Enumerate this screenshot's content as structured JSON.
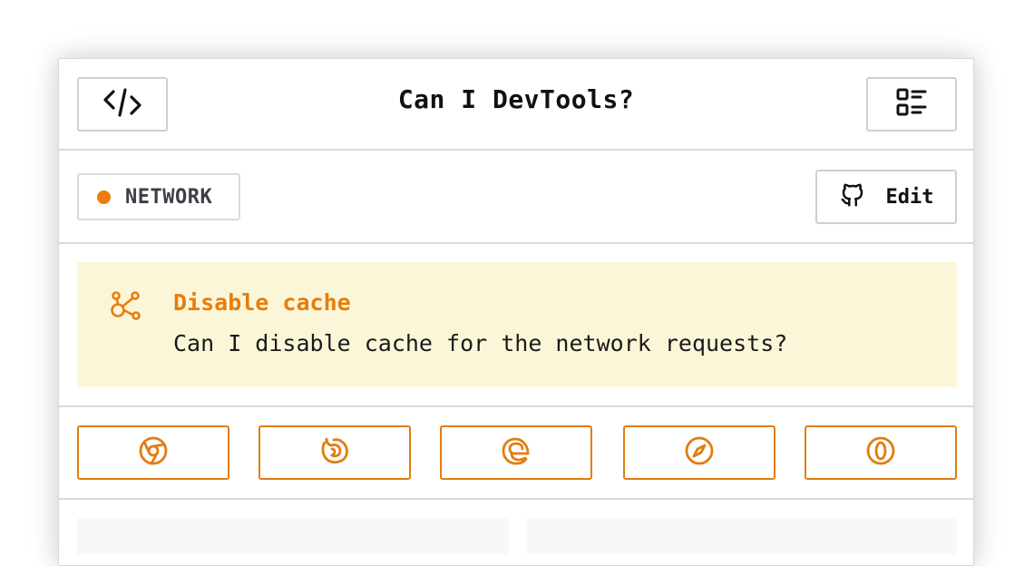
{
  "header": {
    "title": "Can I DevTools?",
    "left_icon": "code-icon",
    "right_icon": "list-icon"
  },
  "category": {
    "label": "NETWORK",
    "color": "#ea7d0c"
  },
  "edit": {
    "label": "Edit",
    "icon": "github-icon"
  },
  "feature": {
    "icon": "network-icon",
    "title": "Disable cache",
    "description": "Can I disable cache for the network requests?",
    "background": "#fcf6d9",
    "accent": "#e67e0c"
  },
  "browsers": [
    {
      "icon": "chrome-icon"
    },
    {
      "icon": "firefox-icon"
    },
    {
      "icon": "edge-icon"
    },
    {
      "icon": "safari-icon"
    },
    {
      "icon": "opera-icon"
    }
  ]
}
